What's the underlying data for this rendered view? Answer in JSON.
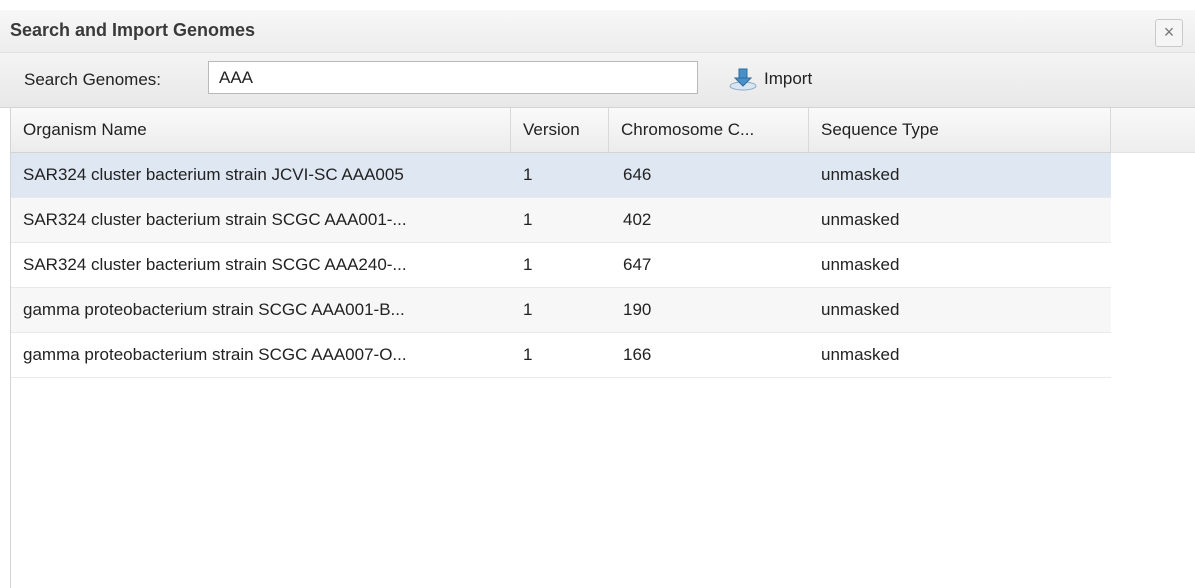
{
  "dialog": {
    "title": "Search and Import Genomes",
    "close_glyph": "×"
  },
  "toolbar": {
    "search_label": "Search Genomes:",
    "search_value": "AAA",
    "import_label": "Import",
    "import_icon": "import-icon"
  },
  "grid": {
    "columns": [
      "Organism Name",
      "Version",
      "Chromosome C...",
      "Sequence Type"
    ],
    "rows": [
      [
        "SAR324 cluster bacterium strain JCVI-SC AAA005",
        "1",
        "646",
        "unmasked"
      ],
      [
        "SAR324 cluster bacterium strain SCGC AAA001-...",
        "1",
        "402",
        "unmasked"
      ],
      [
        "SAR324 cluster bacterium strain SCGC AAA240-...",
        "1",
        "647",
        "unmasked"
      ],
      [
        "gamma proteobacterium strain SCGC AAA001-B...",
        "1",
        "190",
        "unmasked"
      ],
      [
        "gamma proteobacterium strain SCGC AAA007-O...",
        "1",
        "166",
        "unmasked"
      ]
    ],
    "selected_row": 0
  },
  "colors": {
    "selected_row": "#dfe7f3",
    "alt_row": "#f7f7f7",
    "import_icon_blue": "#4a90c8"
  }
}
